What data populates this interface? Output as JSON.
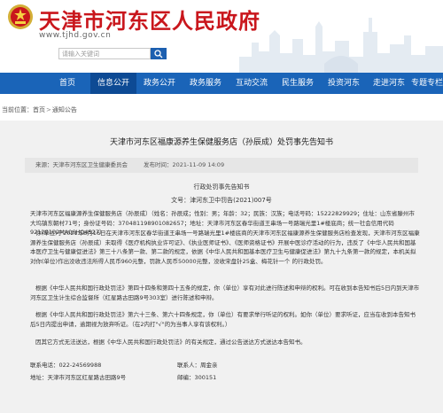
{
  "site": {
    "title": "天津市河东区人民政府",
    "domain": "www.tjhd.gov.cn",
    "search_placeholder": "请输入关键词"
  },
  "nav": {
    "items": [
      {
        "label": "首页"
      },
      {
        "label": "信息公开"
      },
      {
        "label": "政务公开"
      },
      {
        "label": "政务服务"
      },
      {
        "label": "互动交流"
      },
      {
        "label": "民生服务"
      },
      {
        "label": "投资河东"
      },
      {
        "label": "走进河东"
      },
      {
        "label": "专题专栏"
      }
    ]
  },
  "breadcrumb": {
    "label": "当前位置：",
    "items": [
      "首页",
      "通知公告"
    ]
  },
  "article": {
    "title": "天津市河东区福康源养生保健服务店（孙辰成）处罚事先告知书",
    "source": "来源：天津市河东区卫生健康委员会",
    "time": "发布时间：2021-11-09 14:09",
    "doc_type": "行政处罚事先告知书",
    "doc_number": "文号：津河东卫中罚告(2021)007号",
    "paragraphs": [
      "天津市河东区福康源养生保健服务店（孙辰成）（姓名：孙辰成；性别：男；年龄：32；民族：汉族；电话号码：15222829929；住址：山东省滕州市大坞镇东朝村71号；身份证号码：370481198901082657；地址：天津市河东区春华街道王串场一号路瑞光里1#楼底商；统一社会信用代码92120102MA06HQ4527）",
      "你(单位)于2021年8月16日在天津市河东区春华街道王串场一号路瑞光里1#楼底商的天津市河东区福康源养生保健服务店检查发现，天津市河东区福康源养生保健服务店（孙辰成）未取得《医疗机构执业许可证》、《执业医师证书》、《医师资格证书》开展中医诊疗活动的行为，违反了《中华人民共和国基本医疗卫生与健康促进法》第三十八条第一款、第二款的规定，依据《中华人民共和国基本医疗卫生与健康促进法》第九十九条第一款的规定，本机关拟对你(单位)作出没收违法所得人民币960元整，罚款人民币50000元整，没收宋盘针25盒、梅花针一个 的行政处罚。",
      "根据《中华人民共和国行政处罚法》第四十四条和第四十五条的规定，你（单位）享有对此进行陈述和申辩的权利。可在收到本告知书后5日内到天津市河东区卫生计生综合监督所（红星路古田路9号303室）进行陈述和申辩。",
      "根据《中华人民共和国行政处罚法》第六十三条、第六十四条规定，你（单位）有要求举行听证的权利。如你（单位）要求听证，应当在收到本告知书后5日内提出申请，逾期视为放弃听证。（在2内打\"√\"的为当事人享有该权利。）",
      "因其它方式无法送达，根据《中华人民共和国行政处罚法》的有关规定，通过公告送达方式送达本告知书。"
    ],
    "contact_phone": "联系电话：022-24569988",
    "contact_person": "联系人：周金亲",
    "address": "地址：天津市河东区红星路古田路9号",
    "postcode": "邮编：300151"
  },
  "colors": {
    "brand_red": "#c9161c",
    "nav_blue": "#1a64b8",
    "nav_active": "#0d4a94",
    "highlight": "#ffd400"
  }
}
